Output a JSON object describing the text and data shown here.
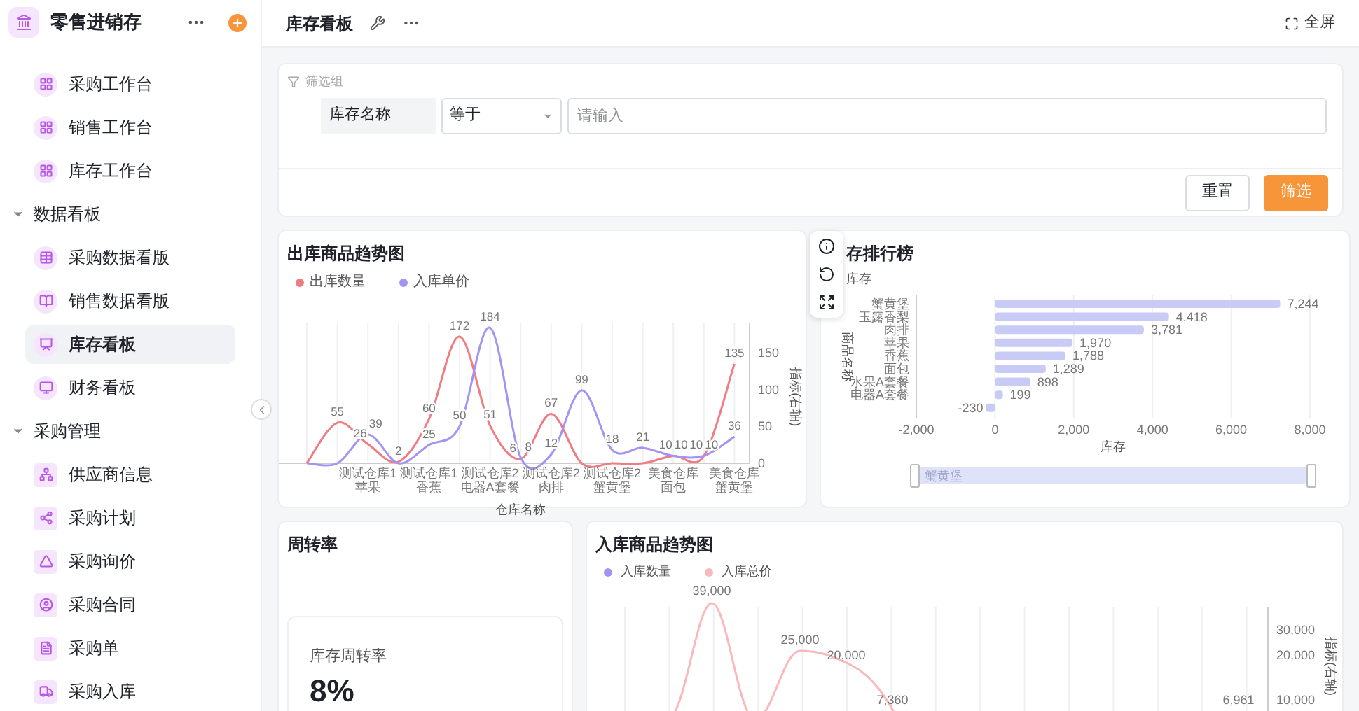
{
  "app": {
    "title": "零售进销存"
  },
  "sidebar": {
    "items": [
      {
        "label": "采购工作台",
        "selected": false
      },
      {
        "label": "销售工作台",
        "selected": false
      },
      {
        "label": "库存工作台",
        "selected": false
      }
    ],
    "groups": [
      {
        "label": "数据看板",
        "expanded": true,
        "items": [
          {
            "label": "采购数据看版",
            "selected": false
          },
          {
            "label": "销售数据看版",
            "selected": false
          },
          {
            "label": "库存看板",
            "selected": true
          },
          {
            "label": "财务看板",
            "selected": false
          }
        ]
      },
      {
        "label": "采购管理",
        "expanded": true,
        "items": [
          {
            "label": "供应商信息",
            "selected": false
          },
          {
            "label": "采购计划",
            "selected": false
          },
          {
            "label": "采购询价",
            "selected": false
          },
          {
            "label": "采购合同",
            "selected": false
          },
          {
            "label": "采购单",
            "selected": false
          },
          {
            "label": "采购入库",
            "selected": false
          }
        ]
      }
    ]
  },
  "header": {
    "title": "库存看板",
    "fullscreen": "全屏"
  },
  "filter": {
    "group_label": "筛选组",
    "field_label": "库存名称",
    "operator": "等于",
    "placeholder": "请输入",
    "reset": "重置",
    "submit": "筛选"
  },
  "outbound_chart": {
    "title": "出库商品趋势图",
    "chart_data": {
      "type": "line",
      "xlabel": "仓库名称",
      "ylabel": "指标(右轴)",
      "categories": [
        null,
        null,
        "测试仓库1苹果",
        null,
        "测试仓库1香蕉",
        null,
        "测试仓库2电器A套餐",
        null,
        "测试仓库2肉排",
        null,
        "测试仓库2蟹黄堡",
        null,
        "美食仓库面包",
        null,
        "美食仓库蟹黄堡"
      ],
      "ylim": [
        0,
        190
      ],
      "yticks": [
        0,
        50,
        100,
        150
      ],
      "grid": true,
      "value_labels": [
        [
          null,
          "55",
          "26",
          "2",
          "60",
          "172",
          "51",
          "6",
          "67",
          null,
          null,
          null,
          "10",
          "10",
          "135"
        ],
        [
          null,
          null,
          "39",
          null,
          "25",
          "50",
          "184",
          "8",
          "12",
          "99",
          "18",
          "21",
          "10",
          "10",
          "36"
        ]
      ],
      "series": [
        {
          "name": "出库数量",
          "color": "#f07c82",
          "values": [
            0,
            55,
            26,
            2,
            60,
            172,
            51,
            6,
            67,
            0,
            0,
            0,
            10,
            10,
            135
          ]
        },
        {
          "name": "入库单价",
          "color": "#a393f5",
          "values": [
            0,
            0,
            39,
            0,
            25,
            50,
            184,
            8,
            12,
            99,
            18,
            21,
            10,
            10,
            36
          ]
        }
      ]
    }
  },
  "ranking_chart": {
    "title": "存排行榜",
    "toolbar": true,
    "zoom_label": "蟹黄堡",
    "chart_data": {
      "type": "bar",
      "orientation": "horizontal",
      "xlabel": "库存",
      "ylabel": "商品名称",
      "categories": [
        "蟹黄堡",
        "玉露香梨",
        "肉排",
        "苹果",
        "香蕉",
        "面包",
        "水果A套餐",
        "电器A套餐",
        null
      ],
      "xlim": [
        -2000,
        8000
      ],
      "xticks": [
        {
          "value": -2000,
          "label": "-2,000"
        },
        {
          "value": 0,
          "label": "0"
        },
        {
          "value": 2000,
          "label": "2,000"
        },
        {
          "value": 4000,
          "label": "4,000"
        },
        {
          "value": 6000,
          "label": "6,000"
        },
        {
          "value": 8000,
          "label": "8,000"
        }
      ],
      "grid": true,
      "value_labels": [
        "7,244",
        "4,418",
        "3,781",
        "1,970",
        "1,788",
        "1,289",
        "898",
        "199",
        "-230"
      ],
      "series": [
        {
          "name": "库存",
          "color": "#c9cbf7",
          "values": [
            7244,
            4418,
            3781,
            1970,
            1788,
            1289,
            898,
            199,
            -230
          ]
        }
      ]
    }
  },
  "turnover": {
    "title": "周转率",
    "metric_label": "库存周转率",
    "metric_value": "8%"
  },
  "inbound_chart": {
    "title": "入库商品趋势图",
    "legend": [
      {
        "name": "入库数量",
        "color": "#a393f5"
      },
      {
        "name": "入库总价",
        "color": "#f9b9bc"
      }
    ],
    "value_labels": [
      "39,000",
      "25,000",
      "20,000",
      "7,360",
      "6,961"
    ],
    "axis_ticks": [
      "30,000",
      "20,000",
      "10,000"
    ],
    "axis_title": "指标(右轴)"
  }
}
